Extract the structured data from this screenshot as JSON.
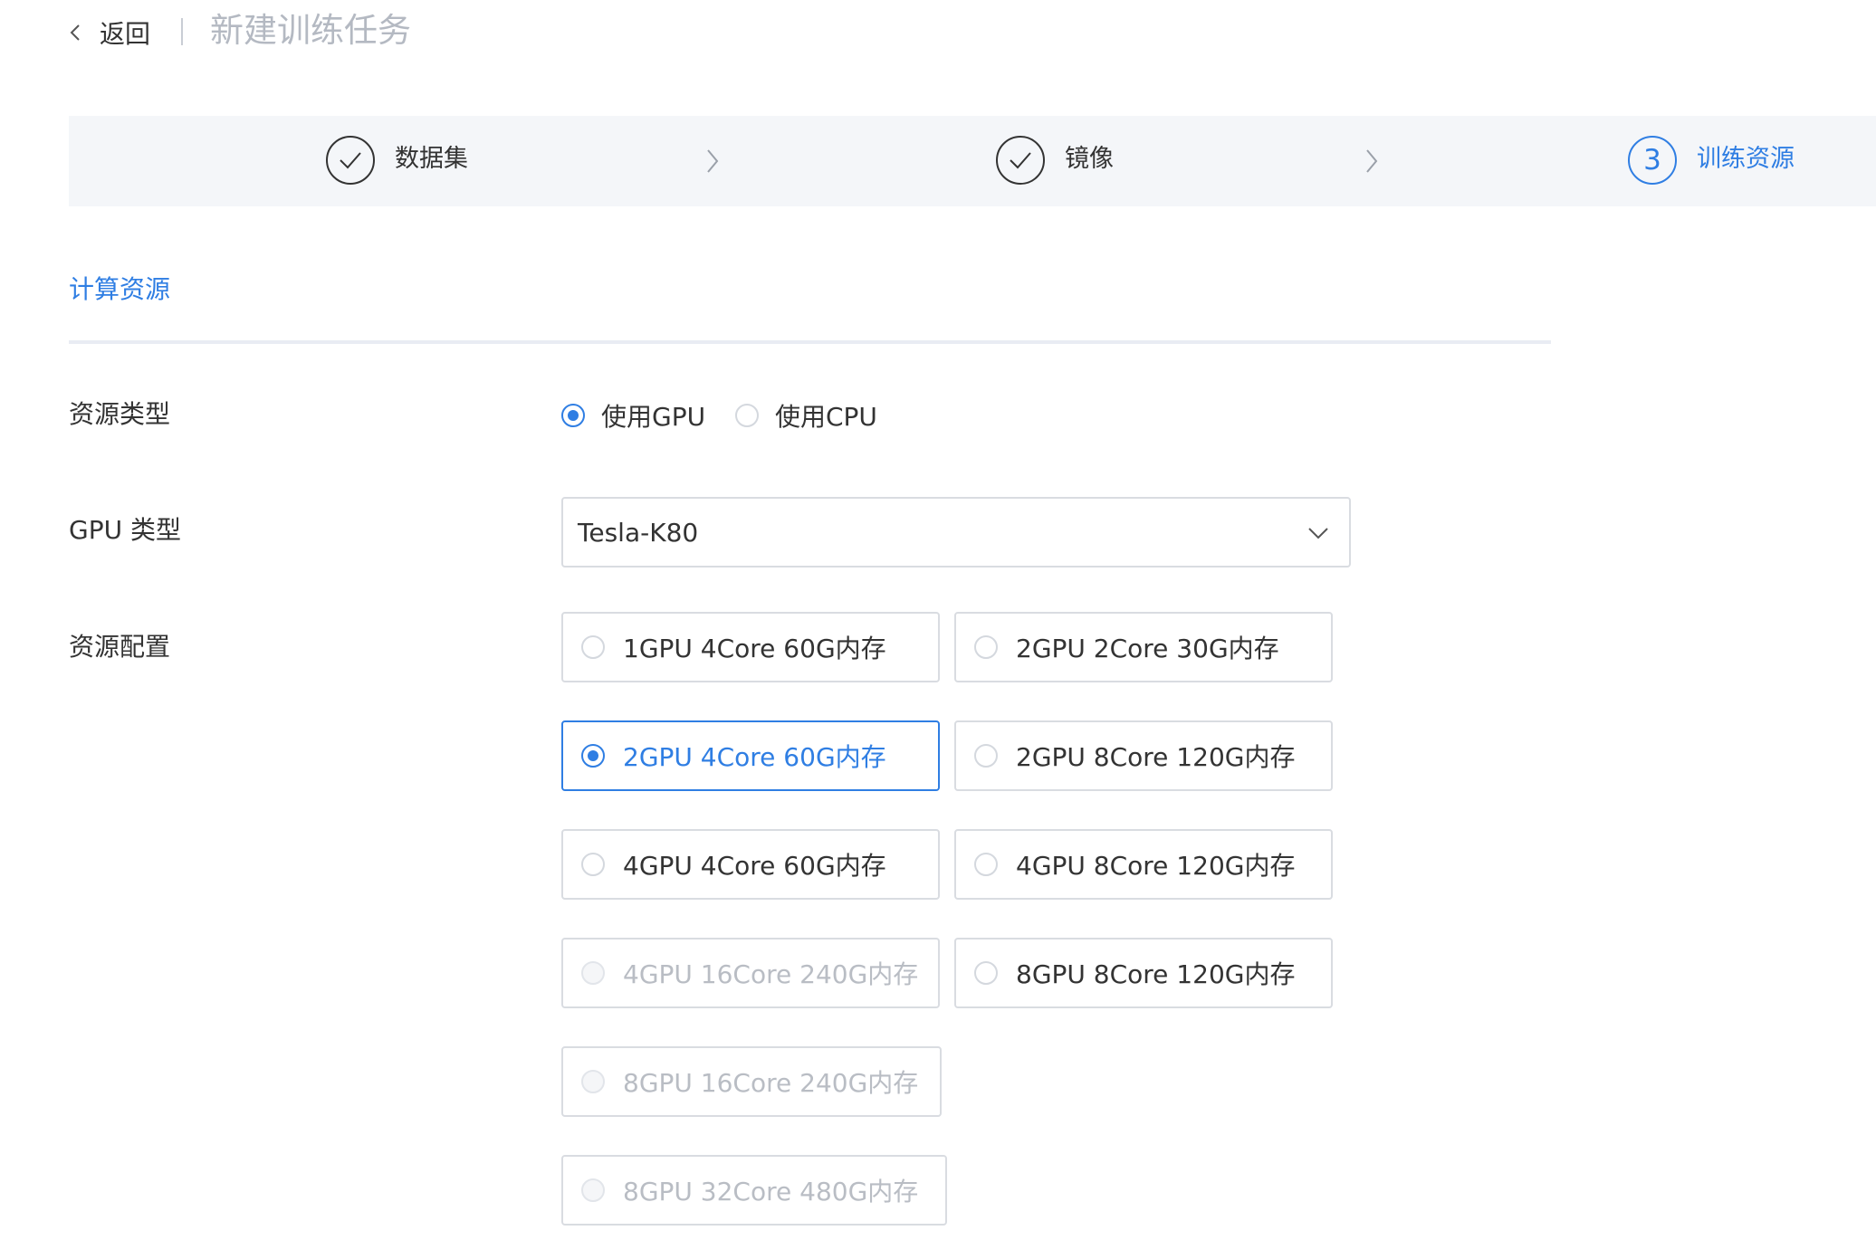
{
  "header": {
    "back_label": "返回",
    "page_title": "新建训练任务"
  },
  "steps": [
    {
      "label": "数据集",
      "state": "done"
    },
    {
      "label": "镜像",
      "state": "done"
    },
    {
      "label": "训练资源",
      "state": "active",
      "number": "3"
    }
  ],
  "section": {
    "title": "计算资源"
  },
  "resource_type": {
    "label": "资源类型",
    "options": [
      {
        "label": "使用GPU",
        "checked": true
      },
      {
        "label": "使用CPU",
        "checked": false
      }
    ]
  },
  "gpu_type": {
    "label": "GPU 类型",
    "value": "Tesla-K80"
  },
  "resource_config": {
    "label": "资源配置",
    "options": [
      {
        "label": "1GPU 4Core 60G内存",
        "state": "normal"
      },
      {
        "label": "2GPU 2Core 30G内存",
        "state": "normal"
      },
      {
        "label": "2GPU 4Core 60G内存",
        "state": "selected"
      },
      {
        "label": "2GPU 8Core 120G内存",
        "state": "normal"
      },
      {
        "label": "4GPU 4Core 60G内存",
        "state": "normal"
      },
      {
        "label": "4GPU 8Core 120G内存",
        "state": "normal"
      },
      {
        "label": "4GPU 16Core 240G内存",
        "state": "disabled"
      },
      {
        "label": "8GPU 8Core 120G内存",
        "state": "normal"
      },
      {
        "label": "8GPU 16Core 240G内存",
        "state": "disabled"
      },
      {
        "label": "8GPU 32Core 480G内存",
        "state": "disabled"
      }
    ]
  },
  "colors": {
    "accent": "#2f7ee3",
    "title_gray": "#b4b9c2",
    "steps_bg": "#f4f6f9",
    "border": "#d9dce1",
    "disabled_text": "#b9bdc4"
  }
}
